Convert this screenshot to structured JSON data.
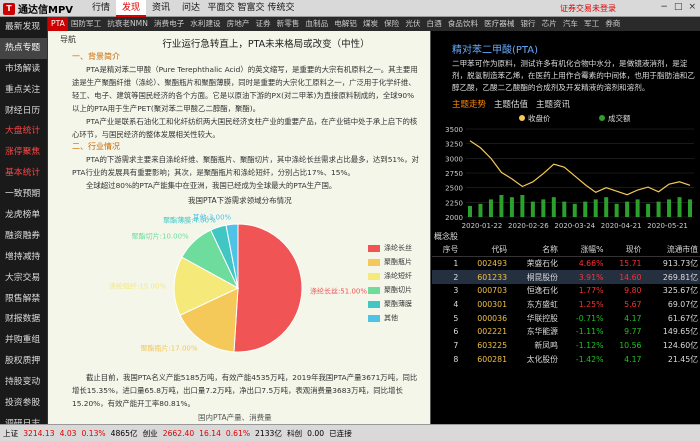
{
  "app": {
    "title": "通达信MPV",
    "promo": "证券交易未登录"
  },
  "topmenu": [
    "行情",
    "发现",
    "资讯",
    "问达",
    "平面交易",
    "智富交易",
    "传统交易"
  ],
  "topmenu_active": 1,
  "window_controls": [
    "−",
    "□",
    "×"
  ],
  "leftnav": [
    "最新发现",
    "热点专题",
    "市场解读",
    "重点关注",
    "财经日历",
    "大盘统计",
    "涨停聚焦",
    "基本统计",
    "一致预期",
    "龙虎榜单",
    "融资融券",
    "增持减持",
    "大宗交易",
    "限售解禁",
    "财报数据",
    "并购重组",
    "股权质押",
    "持股变动",
    "投资参股",
    "调研日志"
  ],
  "leftnav_active": 1,
  "leftnav_red": [
    5,
    6,
    7
  ],
  "subtabs": [
    "PTA",
    "国防军工",
    "抗衰老NMN",
    "消费电子",
    "水利建设",
    "房地产",
    "证券",
    "新零售",
    "血制品",
    "电解铝",
    "煤炭",
    "保险",
    "光伏",
    "白酒",
    "食品饮料",
    "医疗器械",
    "银行",
    "芯片",
    "汽车",
    "军工",
    "券商"
  ],
  "subtabs_active": 0,
  "doc": {
    "nav": [
      "导航",
      "概述",
      "行业分析",
      "主题估值",
      "主题资讯"
    ],
    "title": "行业运行急转直上，PTA未来格局或改变（中性）",
    "h1": "一、背景简介",
    "p1": "PTA是精对苯二甲酸（Pure Terephthalic Acid）的英文缩写，是重要的大宗有机原料之一。其主要用途是生产聚酯纤维（涤纶）、聚酯瓶片和聚酯薄膜，同时是重要的大宗化工原料之一，广泛用于化学纤维、轻工、电子、建筑等国民经济的各个方面。它是以原油下游的PX(对二甲苯)为直接原料制成的，全球90%以上的PTA用于生产PET(聚对苯二甲酸乙二醇酯，聚酯)。",
    "p2": "PTA产业是联系石油化工和化纤纺织两大国民经济支柱产业的重要产品，在产业链中处于承上启下的核心环节，与国民经济的整体发展相关性较大。",
    "h2": "二、行业情况",
    "p3": "PTA的下游需求主要来自涤纶纤维、聚酯瓶片、聚酯切片，其中涤纶长丝需求占比最多，达到51%，对PTA行业的发展具有重要影响；其次，是聚酯瓶片和涤纶短纤，分别占比17%、15%。",
    "p4": "全球超过80%的PTA产能集中在亚洲，我国已经成为全球最大的PTA生产国。",
    "pie_title": "我国PTA下游需求领域分布情况",
    "p5": "截止目前，我国PTA名义产能5185万吨，有效产能4535万吨，2019年我国PTA产量3671万吨，同比增长15.35%，进口量65.8万吨，出口量7.2万吨，净出口7.5万吨，表观消费量3683万吨，同比增长15.20%，有效产能开工率80.81%。",
    "table_caption": "国内PTA产量、消费量"
  },
  "chart_data": [
    {
      "type": "pie",
      "title": "我国PTA下游需求领域分布情况",
      "categories": [
        "涤纶长丝",
        "聚酯瓶片",
        "涤纶短纤",
        "聚酯切片",
        "聚酯薄膜",
        "其他"
      ],
      "values": [
        51.0,
        17.0,
        15.0,
        10.0,
        4.0,
        3.0
      ],
      "data_labels": [
        "涤纶长丝:51.00%",
        "聚酯瓶片:17.00%",
        "涤纶短纤:15.00%",
        "聚酯切片:10.00%",
        "聚酯薄膜:4.00%",
        "其他:3.00%"
      ],
      "colors": [
        "#f05454",
        "#f5c85a",
        "#f5e97a",
        "#6ddc9c",
        "#42c6c4",
        "#4fc3e6"
      ],
      "legend": "right"
    },
    {
      "type": "line",
      "series": [
        {
          "name": "收盘价",
          "color": "#f5c85a",
          "values": [
            3300,
            3180,
            3000,
            2760,
            2650,
            2520,
            2600,
            2740,
            2900,
            2850,
            2700,
            2550,
            2420,
            2500,
            2440,
            2380,
            2460,
            2510,
            2430,
            2560,
            2600,
            2540
          ]
        },
        {
          "name": "成交额",
          "color": "#2ca02c",
          "type": "bar",
          "values": [
            0.5,
            0.6,
            0.8,
            1.0,
            0.9,
            1.0,
            0.7,
            0.8,
            0.9,
            0.7,
            0.6,
            0.7,
            0.8,
            0.9,
            0.6,
            0.7,
            0.8,
            0.6,
            0.7,
            0.8,
            0.9,
            0.8
          ]
        }
      ],
      "ylim": [
        2000,
        3500
      ],
      "yticks": [
        "3500",
        "3250",
        "3000",
        "2750",
        "2500",
        "2250",
        "2000"
      ],
      "xticks": [
        "2020-01-22",
        "2020-02-26",
        "2020-03-24",
        "2020-04-21",
        "2020-05-21"
      ]
    }
  ],
  "right": {
    "title": "精对苯二甲酸(PTA)",
    "intro": "二甲苯可作为原料，测试许多有机化合物中水分，是做镜液消剂，是淀剂，脱氢制造苯乙烯，在医药上用作合霉素的中间体，也用于脂肪油和乙醇乙酸，乙酸二乙酸酯的合成剂及开发精液的溶剂和溶剂。",
    "tabs": [
      "主题走势",
      "主题估值",
      "主题资讯"
    ],
    "tabs_active": 0,
    "legend": [
      "收盘价",
      "成交额"
    ],
    "gn_caption": "概念股",
    "table_headers": [
      "序号",
      "代码",
      "名称",
      "涨幅%",
      "现价",
      "流通市值"
    ],
    "rows": [
      [
        "1",
        "002493",
        "荣盛石化",
        "4.66%",
        "15.71",
        "913.73亿"
      ],
      [
        "2",
        "601233",
        "桐昆股份",
        "3.91%",
        "14.60",
        "269.81亿"
      ],
      [
        "3",
        "000703",
        "恒逸石化",
        "1.77%",
        "9.80",
        "325.67亿"
      ],
      [
        "4",
        "000301",
        "东方盛虹",
        "1.25%",
        "5.67",
        "69.07亿"
      ],
      [
        "5",
        "000036",
        "华联控股",
        "-0.71%",
        "4.17",
        "61.67亿"
      ],
      [
        "6",
        "002221",
        "东华能源",
        "-1.11%",
        "9.77",
        "149.65亿"
      ],
      [
        "7",
        "603225",
        "新凤鸣",
        "-1.12%",
        "10.56",
        "124.60亿"
      ],
      [
        "8",
        "600281",
        "太化股份",
        "-1.42%",
        "4.17",
        "21.45亿"
      ]
    ],
    "selected_row": 1
  },
  "status": {
    "items": [
      "上证",
      "3214.13",
      "4.03",
      "0.13%",
      "4865亿",
      "创业",
      "2662.40",
      "16.14",
      "0.61%",
      "2133亿",
      "科创",
      "0.00",
      "已连接"
    ]
  },
  "colors": {
    "red": "#ff3030",
    "green": "#20c020",
    "yellow": "#f0c040"
  }
}
